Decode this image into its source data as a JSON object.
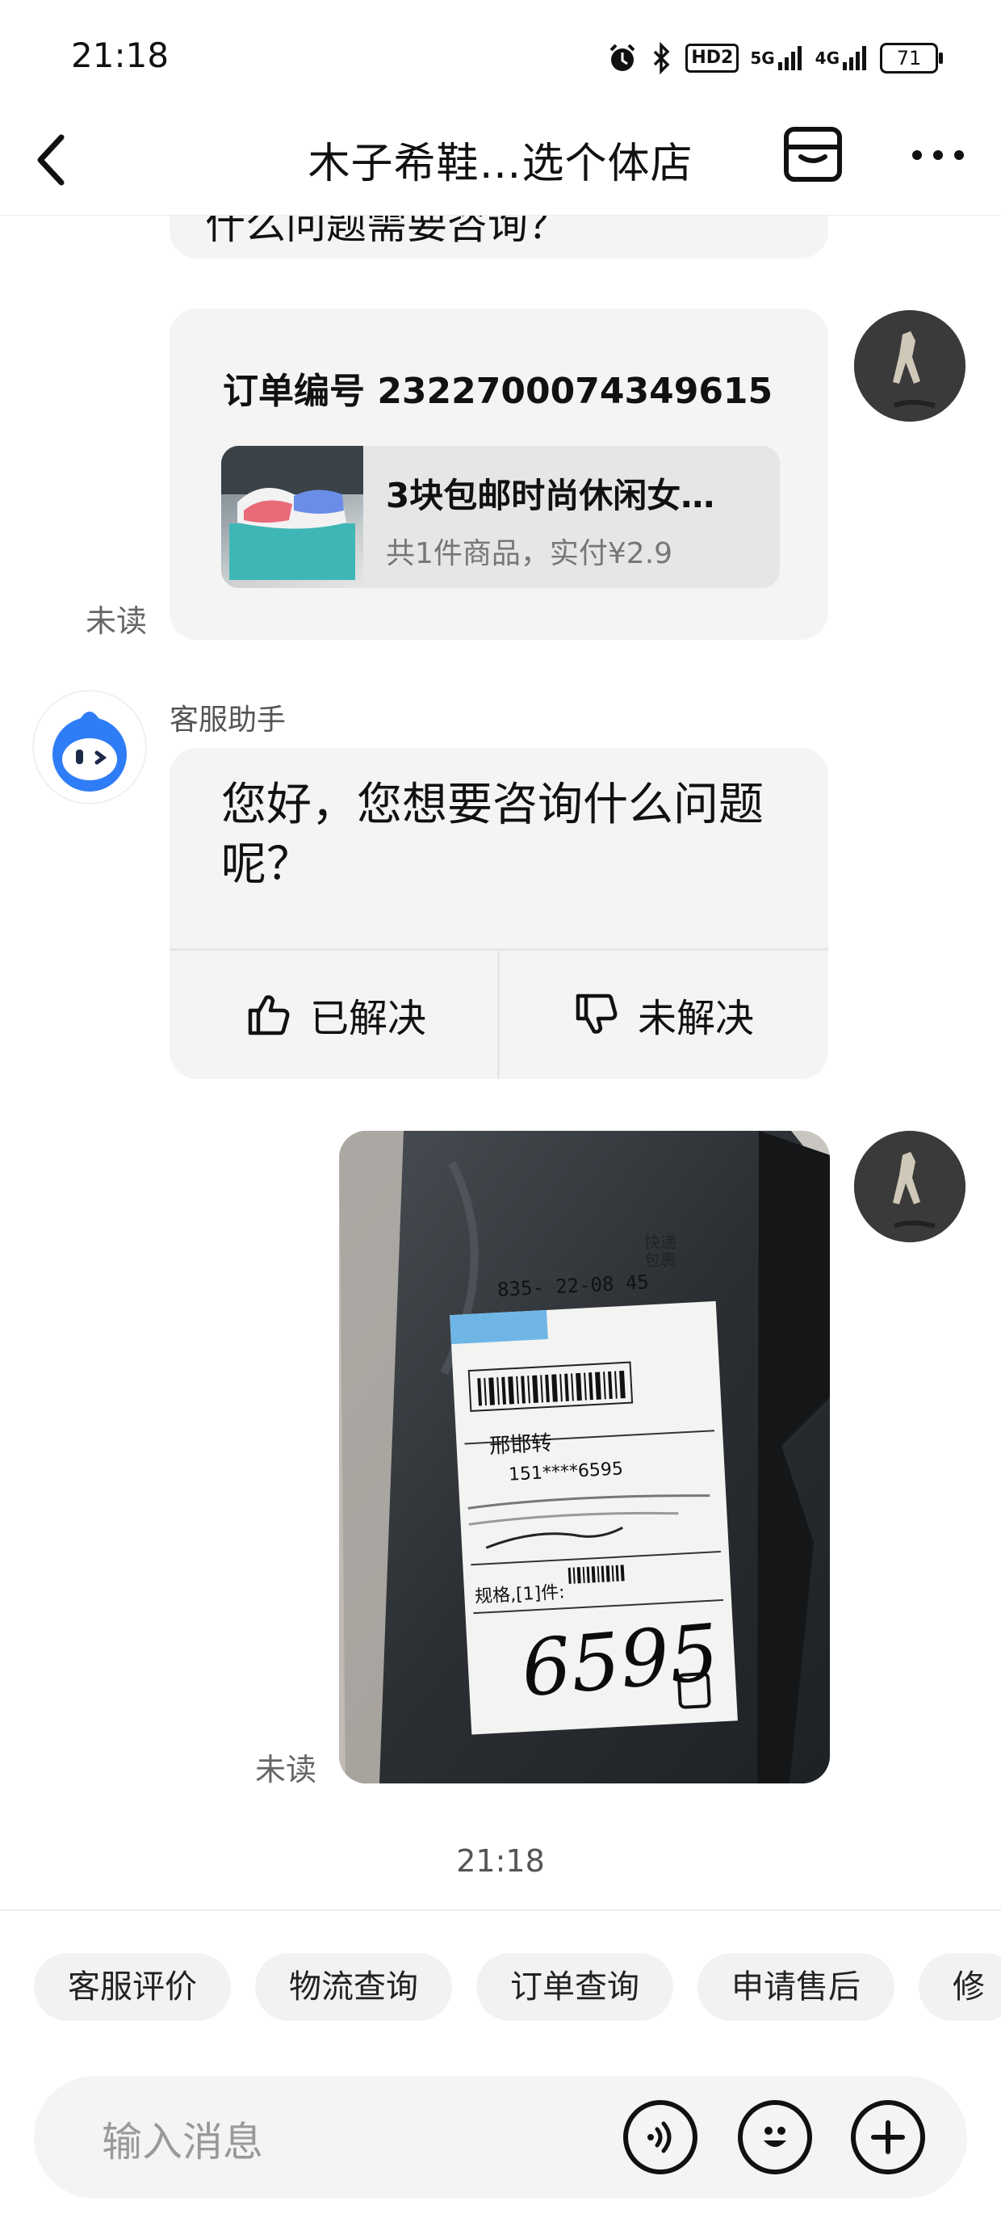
{
  "status_bar": {
    "time": "21:18",
    "network_5g": "5G",
    "network_4g": "4G",
    "hd_label": "HD2",
    "battery": "71"
  },
  "nav": {
    "title": "木子希鞋…选个体店"
  },
  "messages": {
    "partial_text": "什么问题需要咨询？",
    "order": {
      "order_no": "订单编号 2322700074349615",
      "product_name": "3块包邮时尚休闲女…",
      "product_summary": "共1件商品，实付¥2.9",
      "unread_label": "未读"
    },
    "bot": {
      "name": "客服助手",
      "message": "您好，您想要咨询什么问题呢？",
      "resolved_label": "已解决",
      "unresolved_label": "未解决"
    },
    "photo": {
      "unread_label": "未读",
      "handwritten_number": "6595",
      "label_code": "835- 22-08 45",
      "station_text": "邢邯转",
      "phone_text": "151****6595",
      "label_spec": "规格,[1]件:",
      "express_tag_1": "快递",
      "express_tag_2": "包裹"
    },
    "time": "21:18"
  },
  "quick_actions": [
    "客服评价",
    "物流查询",
    "订单查询",
    "申请售后",
    "修"
  ],
  "input": {
    "placeholder": "输入消息"
  },
  "colors": {
    "bubble": "#f4f4f4",
    "bot_blue": "#2f7df6"
  }
}
